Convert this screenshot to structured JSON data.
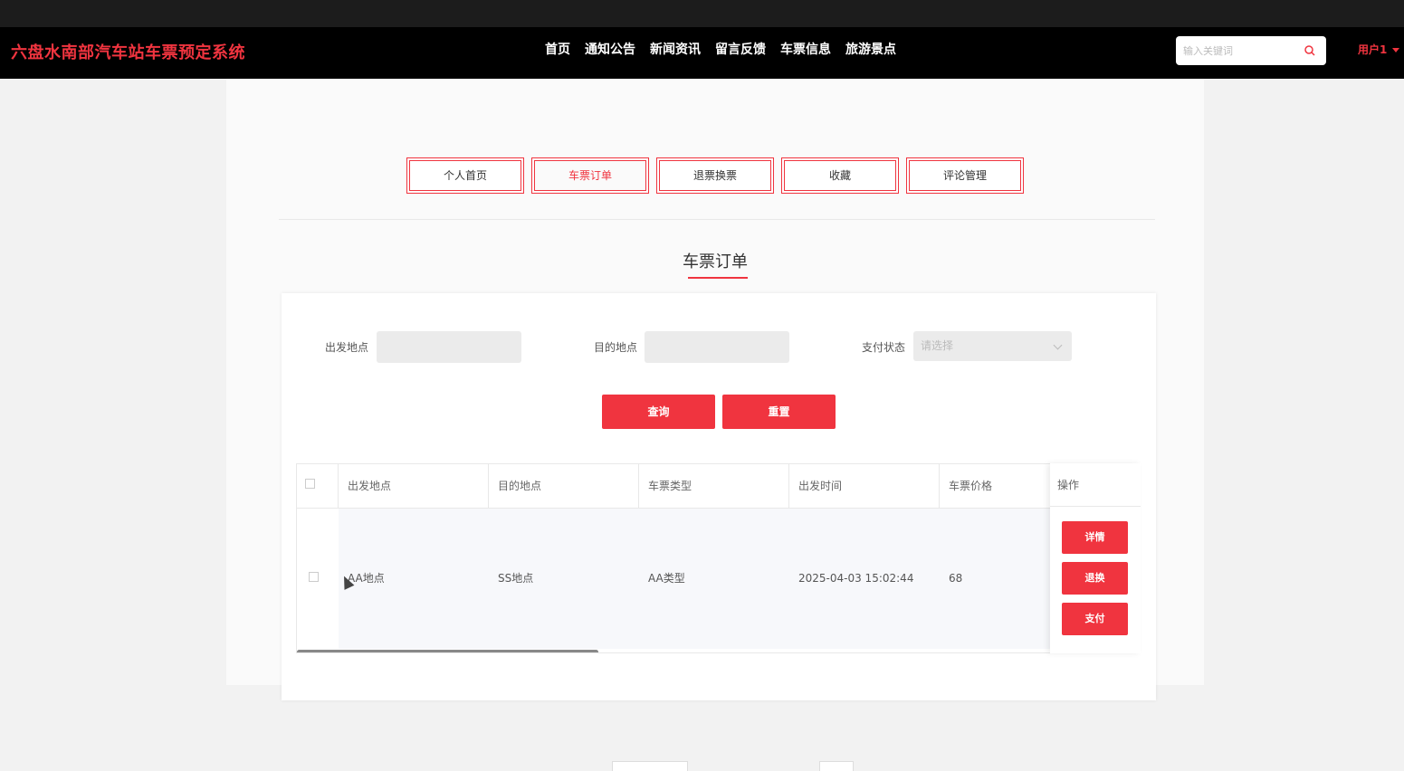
{
  "header": {
    "brand": "六盘水南部汽车站车票预定系统",
    "nav": [
      "首页",
      "通知公告",
      "新闻资讯",
      "留言反馈",
      "车票信息",
      "旅游景点"
    ],
    "search_placeholder": "输入关键词",
    "user_label": "用户1"
  },
  "tabs": [
    {
      "label": "个人首页",
      "active": false
    },
    {
      "label": "车票订单",
      "active": true
    },
    {
      "label": "退票换票",
      "active": false
    },
    {
      "label": "收藏",
      "active": false
    },
    {
      "label": "评论管理",
      "active": false
    }
  ],
  "section_title": "车票订单",
  "filters": {
    "departure_label": "出发地点",
    "destination_label": "目的地点",
    "pay_status_label": "支付状态",
    "pay_status_placeholder": "请选择",
    "query_button": "查询",
    "reset_button": "重置"
  },
  "table": {
    "columns": [
      "出发地点",
      "目的地点",
      "车票类型",
      "出发时间",
      "车票价格"
    ],
    "op_column": "操作",
    "rows": [
      {
        "departure": "AA地点",
        "destination": "SS地点",
        "ticket_type": "AA类型",
        "depart_time": "2025-04-03 15:02:44",
        "price": "68"
      }
    ],
    "row_actions": [
      "详情",
      "退换",
      "支付"
    ]
  },
  "colors": {
    "accent": "#f0343f",
    "header_bg": "#000000"
  }
}
